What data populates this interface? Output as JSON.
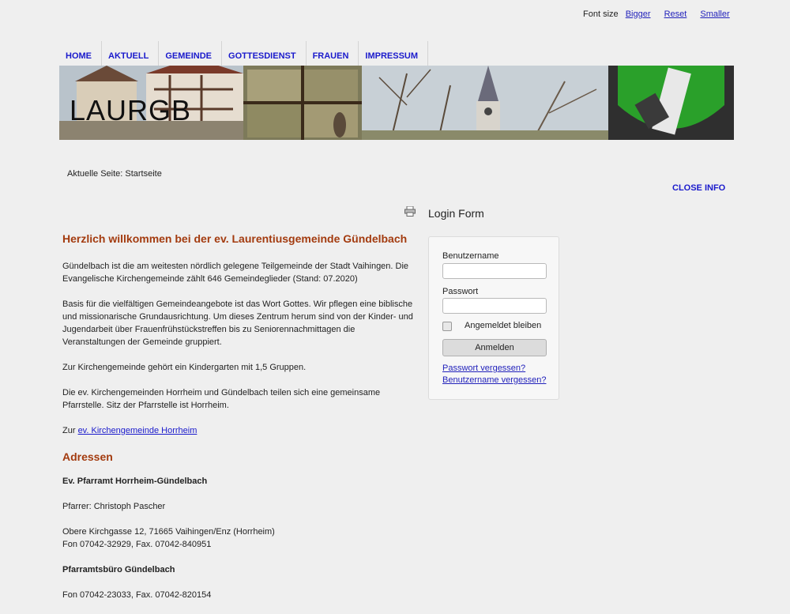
{
  "font_size": {
    "label": "Font size",
    "bigger": "Bigger",
    "reset": "Reset",
    "smaller": "Smaller"
  },
  "nav": {
    "items": [
      "HOME",
      "AKTUELL",
      "GEMEINDE",
      "GOTTESDIENST",
      "FRAUEN",
      "IMPRESSUM"
    ]
  },
  "site_name": "LAURGB",
  "breadcrumb": "Aktuelle Seite: Startseite",
  "close_info": "CLOSE INFO",
  "main": {
    "title": "Herzlich willkommen bei der ev. Laurentiusgemeinde Gündelbach",
    "p1": "Gündelbach ist die am weitesten nördlich gelegene Teilgemeinde der Stadt Vaihingen. Die Evangelische Kirchengemeinde zählt 646 Gemeindeglieder (Stand: 07.2020)",
    "p2": "Basis für die vielfältigen Gemeindeangebote ist das Wort Gottes. Wir pflegen eine biblische und missionarische Grundausrichtung. Um dieses Zentrum herum sind von der Kinder- und Jugendarbeit über Frauenfrühstückstreffen bis zu Seniorennachmittagen die Veranstaltungen der Gemeinde gruppiert.",
    "p3": "Zur Kirchengemeinde gehört ein Kindergarten mit 1,5 Gruppen.",
    "p4": "Die ev. Kirchengemeinden Horrheim und Gündelbach teilen sich eine gemeinsame Pfarrstelle. Sitz der Pfarrstelle ist Horrheim.",
    "p5_prefix": "Zur",
    "p5_link": "ev. Kirchengemeinde Horrheim",
    "addresses_title": "Adressen",
    "office_title": "Ev. Pfarramt Horrheim-Gündelbach",
    "pastor": "Pfarrer: Christoph Pascher",
    "address_line1": "Obere Kirchgasse 12, 71665 Vaihingen/Enz (Horrheim)",
    "address_line2": "Fon 07042-32929, Fax. 07042-840951",
    "office2_title": "Pfarramtsbüro Gündelbach",
    "office2_phone": "Fon 07042-23033, Fax. 07042-820154"
  },
  "login": {
    "title": "Login Form",
    "username_label": "Benutzername",
    "password_label": "Passwort",
    "remember_label": "Angemeldet bleiben",
    "submit": "Anmelden",
    "forgot_password": "Passwort vergessen?",
    "forgot_username": "Benutzername vergessen?"
  },
  "colors": {
    "accent_heading": "#a33b0f",
    "link": "#1a1acc",
    "background": "#efefef"
  },
  "icons": {
    "print": "printer-icon"
  }
}
